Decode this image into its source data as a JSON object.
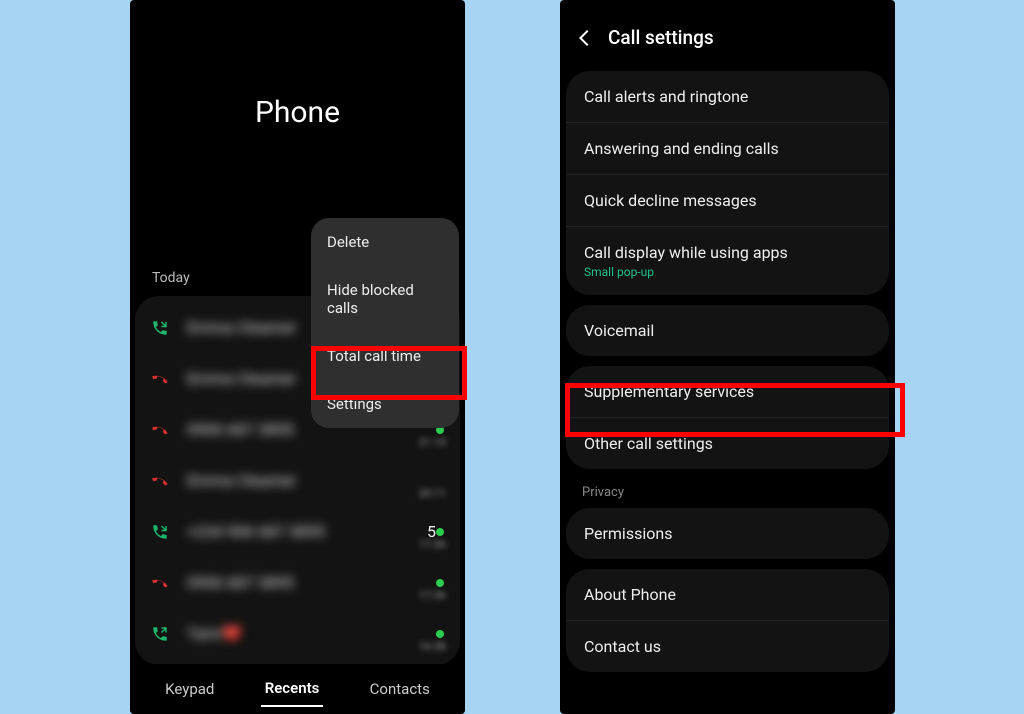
{
  "left": {
    "title": "Phone",
    "today": "Today",
    "popup": {
      "delete": "Delete",
      "hide": "Hide blocked calls",
      "total": "Total call time",
      "settings": "Settings"
    },
    "tabs": {
      "keypad": "Keypad",
      "recents": "Recents",
      "contacts": "Contacts"
    },
    "calls": [
      {
        "name": "Emma Cleamer",
        "type": "in",
        "time": ""
      },
      {
        "name": "Emma Cleamer",
        "type": "missed",
        "time": ""
      },
      {
        "name": "0906 687 3895",
        "type": "missed",
        "time": "21:15",
        "dot": true
      },
      {
        "name": "Emma Cleamer",
        "type": "missed",
        "time": "20:11"
      },
      {
        "name": "+234 906 687 3895",
        "type": "in",
        "time": "17:36",
        "dot": true
      },
      {
        "name": "0906 687 3895",
        "type": "missed",
        "time": "17:36",
        "dot": true
      },
      {
        "name": "Tami❤️",
        "type": "out",
        "time": "16:38",
        "dot": true
      }
    ]
  },
  "right": {
    "title": "Call settings",
    "group1": {
      "alerts": "Call alerts and ringtone",
      "answering": "Answering and ending calls",
      "decline": "Quick decline messages",
      "display": "Call display while using apps",
      "display_sub": "Small pop-up"
    },
    "group2": {
      "voicemail": "Voicemail"
    },
    "group3": {
      "supp": "Supplementary services",
      "other": "Other call settings"
    },
    "privacy_header": "Privacy",
    "group4": {
      "permissions": "Permissions"
    },
    "group5": {
      "about": "About Phone",
      "contact": "Contact us"
    }
  }
}
